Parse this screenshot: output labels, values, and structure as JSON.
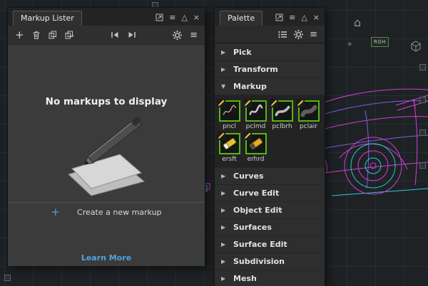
{
  "colors": {
    "accent_blue": "#4da3e0",
    "tool_border_green": "#56b515",
    "wire_magenta": "#d23ed2",
    "wire_purple": "#7e5fe0",
    "wire_cyan": "#2ec8dc"
  },
  "icons": {
    "add": "+",
    "menu": "≡",
    "collapse": "△",
    "close": "×",
    "arrow_collapsed": "▶",
    "arrow_expanded": "▼",
    "home": "⌂"
  },
  "markup_lister": {
    "title": "Markup Lister",
    "empty_state": "No markups to display",
    "create_label": "Create a new markup",
    "learn_more": "Learn More"
  },
  "palette": {
    "title": "Palette",
    "sections": [
      {
        "label": "Pick"
      },
      {
        "label": "Transform"
      },
      {
        "label": "Markup"
      },
      {
        "label": "Curves"
      },
      {
        "label": "Curve Edit"
      },
      {
        "label": "Object Edit"
      },
      {
        "label": "Surfaces"
      },
      {
        "label": "Surface Edit"
      },
      {
        "label": "Subdivision"
      },
      {
        "label": "Mesh"
      }
    ],
    "tools": [
      "pncl",
      "pclmd",
      "pclbrh",
      "pclair",
      "ersft",
      "erhrd"
    ]
  },
  "background": {
    "rgh_badge": "RGH"
  }
}
